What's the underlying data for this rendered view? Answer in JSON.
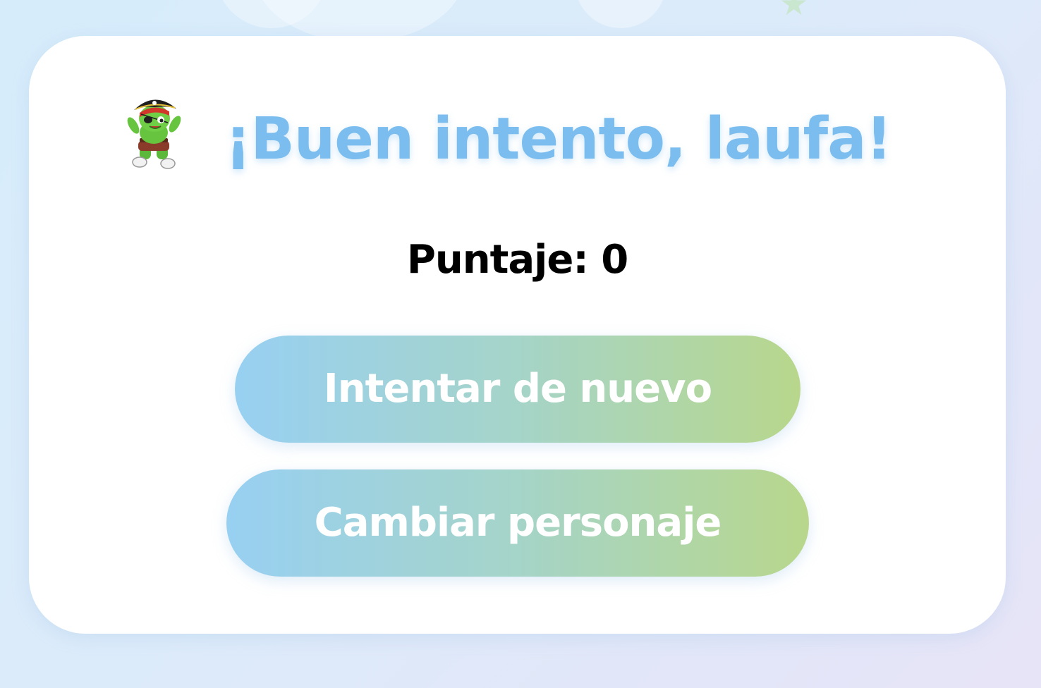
{
  "result": {
    "title": "¡Buen intento, laufa!",
    "score_text": "Puntaje: 0",
    "avatar_icon": "pirate-gummy-bear-icon"
  },
  "actions": {
    "retry_label": "Intentar de nuevo",
    "change_character_label": "Cambiar personaje"
  },
  "colors": {
    "title": "#7bbdee",
    "button_gradient_start": "#98d0f2",
    "button_gradient_end": "#b8d78c",
    "background": "#dcebfa"
  }
}
